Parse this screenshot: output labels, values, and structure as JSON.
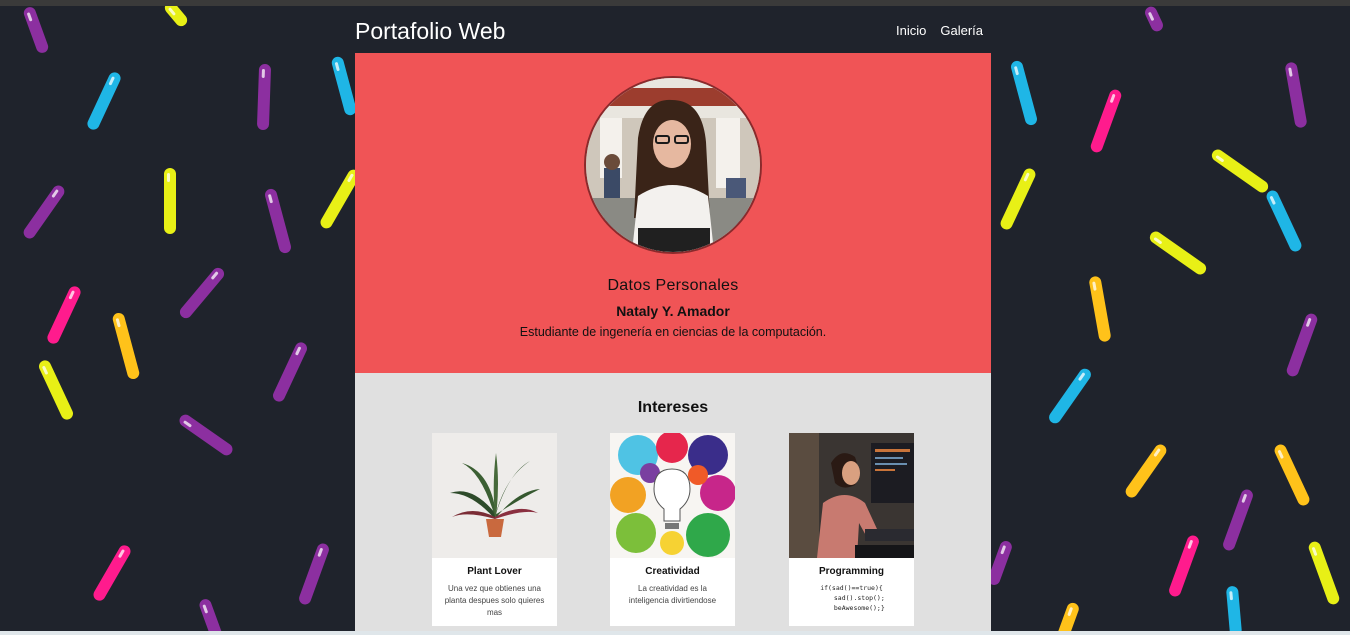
{
  "nav": {
    "brand": "Portafolio Web",
    "links": [
      "Inicio",
      "Galería"
    ]
  },
  "hero": {
    "section_title": "Datos Personales",
    "name": "Nataly Y. Amador",
    "description": "Estudiante de ingenería en ciencias de la computación."
  },
  "interests": {
    "title": "Intereses",
    "cards": [
      {
        "title": "Plant Lover",
        "text": "Una vez que obtienes una planta despues solo quieres mas"
      },
      {
        "title": "Creatividad",
        "text": "La creatividad es la inteligencia divirtiendose"
      },
      {
        "title": "Programming",
        "code": "if(sad()==true){\n    sad().stop();\n    beAwesome();}"
      }
    ]
  },
  "colors": {
    "page_background": "#1f232c",
    "hero_background": "#f05456",
    "interests_background": "#e0e0e0",
    "sprinkles": [
      "#8c2fa0",
      "#1fb6e6",
      "#e8f016",
      "#ff1b8d",
      "#ffc21a"
    ]
  }
}
